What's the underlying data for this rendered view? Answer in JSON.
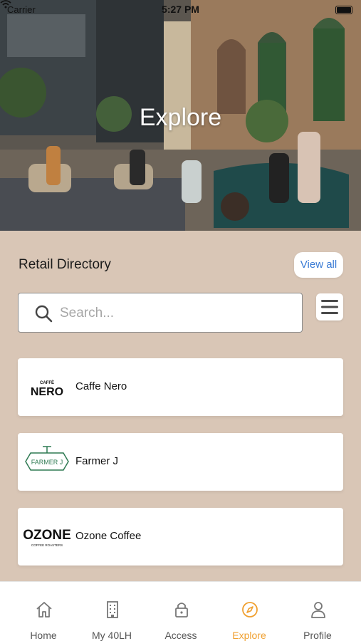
{
  "status_bar": {
    "carrier": "Carrier",
    "time": "5:27 PM"
  },
  "hero": {
    "title": "Explore"
  },
  "directory": {
    "title": "Retail Directory",
    "view_all_label": "View all",
    "search": {
      "placeholder": "Search...",
      "value": ""
    },
    "items": [
      {
        "name": "Caffe Nero",
        "logo_text": "NERO",
        "logo_small": "CAFFÈ"
      },
      {
        "name": "Farmer J",
        "logo_text": "FARMER J"
      },
      {
        "name": "Ozone Coffee",
        "logo_text": "OZONE",
        "logo_small": "COFFEE ROASTERS"
      }
    ]
  },
  "tabs": [
    {
      "label": "Home",
      "icon": "home-icon",
      "active": false
    },
    {
      "label": "My 40LH",
      "icon": "building-icon",
      "active": false
    },
    {
      "label": "Access",
      "icon": "lock-icon",
      "active": false
    },
    {
      "label": "Explore",
      "icon": "compass-icon",
      "active": true
    },
    {
      "label": "Profile",
      "icon": "person-icon",
      "active": false
    }
  ],
  "colors": {
    "accent": "#f0a030",
    "link": "#3a7bd5",
    "background": "#d9c6b6"
  }
}
